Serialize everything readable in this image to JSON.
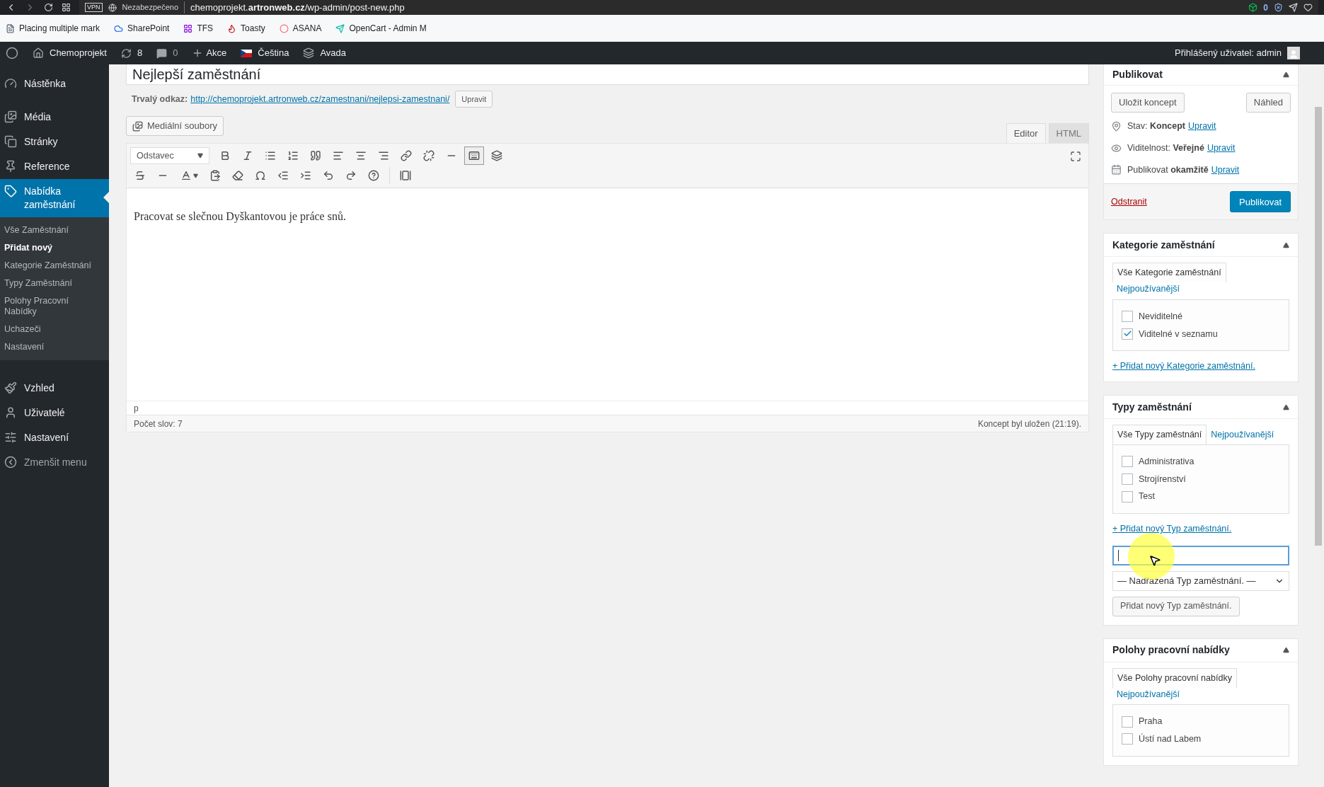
{
  "browser": {
    "vpn": "VPN",
    "security": "Nezabezpečeno",
    "url": "chemoprojekt.**artronweb.cz**/wp-admin/post-new.php",
    "extension_count": "0"
  },
  "bookmarks": [
    {
      "label": "Placing multiple mark"
    },
    {
      "label": "SharePoint"
    },
    {
      "label": "TFS"
    },
    {
      "label": "Toasty"
    },
    {
      "label": "ASANA"
    },
    {
      "label": "OpenCart - Admin M"
    }
  ],
  "admin_bar": {
    "site": "Chemoprojekt",
    "updates": "8",
    "comments": "0",
    "new": "Akce",
    "language": "Čeština",
    "theme": "Avada",
    "user": "Přihlášený uživatel: admin"
  },
  "sidebar": {
    "items": [
      {
        "label": "Nástěnka",
        "selected": false
      },
      {
        "label": "Média",
        "selected": false
      },
      {
        "label": "Stránky",
        "selected": false
      },
      {
        "label": "Reference",
        "selected": false
      },
      {
        "label": "Nabídka zaměstnání",
        "selected": true,
        "children": [
          {
            "label": "Vše Zaměstnání",
            "selected": false
          },
          {
            "label": "Přidat nový",
            "selected": true
          },
          {
            "label": "Kategorie Zaměstnání",
            "selected": false
          },
          {
            "label": "Typy Zaměstnání",
            "selected": false
          },
          {
            "label": "Polohy Pracovní Nabídky",
            "selected": false
          },
          {
            "label": "Uchazeči",
            "selected": false
          },
          {
            "label": "Nastavení",
            "selected": false
          }
        ]
      },
      {
        "label": "Vzhled",
        "selected": false
      },
      {
        "label": "Uživatelé",
        "selected": false
      },
      {
        "label": "Nastavení",
        "selected": false
      },
      {
        "label": "Zmenšit menu",
        "selected": false
      }
    ]
  },
  "editor": {
    "title": "Nejlepší zaměstnání",
    "permalink_label": "Trvalý odkaz:",
    "permalink": "http://chemoprojekt.artronweb.cz/zamestnani/nejlepsi-zamestnani/",
    "permalink_button": "Upravit",
    "media_button": "Mediální soubory",
    "tabs": [
      {
        "label": "Editor",
        "selected": true
      },
      {
        "label": "HTML",
        "selected": false
      }
    ],
    "format": "Odstavec",
    "content": "Pracovat se slečnou Dyškantovou je práce snů.",
    "path": "p",
    "word_count": "Počet slov: 7",
    "saved": "Koncept byl uložen (21:19)."
  },
  "publish": {
    "title": "Publikovat",
    "save_draft": "Uložit koncept",
    "preview": "Náhled",
    "rows": [
      {
        "label": "Stav:",
        "value": "Koncept",
        "link": "Upravit"
      },
      {
        "label": "Viditelnost:",
        "value": "Veřejné",
        "link": "Upravit"
      },
      {
        "label": "Publikovat",
        "value": "okamžitě",
        "link": "Upravit"
      }
    ],
    "delete": "Odstranit",
    "publish": "Publikovat"
  },
  "taxonomies": [
    {
      "title": "Kategorie zaměstnání",
      "tabs": [
        {
          "label": "Vše Kategorie zaměstnání",
          "selected": true
        },
        {
          "label": "Nejpoužívanější",
          "selected": false
        }
      ],
      "tabs_wrap": true,
      "items": [
        {
          "label": "Neviditelné",
          "checked": false
        },
        {
          "label": "Viditelné v seznamu",
          "checked": true
        }
      ],
      "add_link": "+ Přidat nový Kategorie zaměstnání."
    },
    {
      "title": "Typy zaměstnání",
      "tabs": [
        {
          "label": "Vše Typy zaměstnání",
          "selected": true
        },
        {
          "label": "Nejpoužívanější",
          "selected": false
        }
      ],
      "tabs_wrap": false,
      "items": [
        {
          "label": "Administrativa",
          "checked": false
        },
        {
          "label": "Strojírenství",
          "checked": false
        },
        {
          "label": "Test",
          "checked": false
        }
      ],
      "add_link": "+ Přidat nový Typ zaměstnání.",
      "add_form": {
        "parent": "— Nadřazená Typ zaměstnání. —",
        "button": "Přidat nový Typ zaměstnání."
      }
    },
    {
      "title": "Polohy pracovní nabídky",
      "tabs": [
        {
          "label": "Vše Polohy pracovní nabídky",
          "selected": true
        },
        {
          "label": "Nejpoužívanější",
          "selected": false
        }
      ],
      "tabs_wrap": true,
      "items": [
        {
          "label": "Praha",
          "checked": false
        },
        {
          "label": "Ústí nad Labem",
          "checked": false
        }
      ]
    }
  ]
}
